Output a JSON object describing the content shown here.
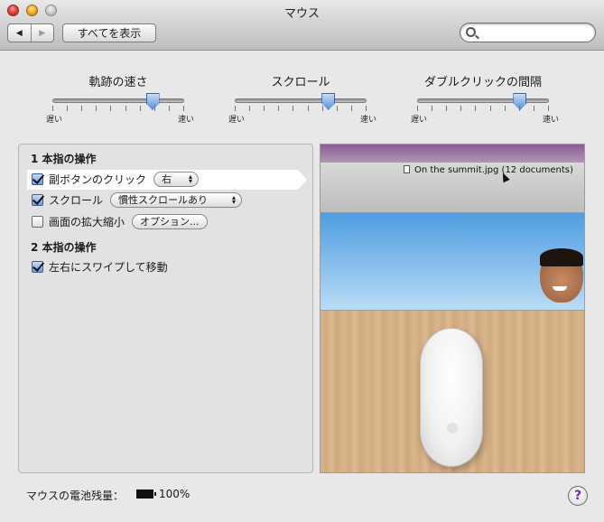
{
  "window": {
    "title": "マウス"
  },
  "toolbar": {
    "back_glyph": "◀",
    "forward_glyph": "▶",
    "show_all_label": "すべてを表示",
    "search_value": "",
    "search_placeholder": ""
  },
  "sliders": [
    {
      "title": "軌跡の速さ",
      "min_label": "遅い",
      "max_label": "速い",
      "value_fraction": 0.75,
      "tick_count": 10
    },
    {
      "title": "スクロール",
      "min_label": "遅い",
      "max_label": "速い",
      "value_fraction": 0.7,
      "tick_count": 10
    },
    {
      "title": "ダブルクリックの間隔",
      "min_label": "遅い",
      "max_label": "速い",
      "value_fraction": 0.77,
      "tick_count": 10
    }
  ],
  "one_finger": {
    "title": "1 本指の操作",
    "secondary_click": {
      "label": "副ボタンのクリック",
      "checked": true,
      "popup_value": "右"
    },
    "scroll": {
      "label": "スクロール",
      "checked": true,
      "popup_value": "慣性スクロールあり"
    },
    "zoom": {
      "label": "画面の拡大縮小",
      "checked": false,
      "options_label": "オプション..."
    }
  },
  "two_finger": {
    "title": "2 本指の操作",
    "swipe": {
      "label": "左右にスワイプして移動",
      "checked": true
    }
  },
  "preview": {
    "document_text": "On the summit.jpg (12 documents)"
  },
  "footer": {
    "battery_label": "マウスの電池残量：",
    "battery_value": "100%",
    "help_glyph": "?"
  },
  "icons": {
    "search": "search-icon",
    "battery": "battery-icon",
    "help": "help-icon",
    "checkbox_checked": "checkmark-icon",
    "popup": "chevron-updown-icon"
  },
  "colors": {
    "accent": "#5a8fd8",
    "close": "#e0443a",
    "minimize": "#f2b02b",
    "help": "#6a2ca4"
  }
}
